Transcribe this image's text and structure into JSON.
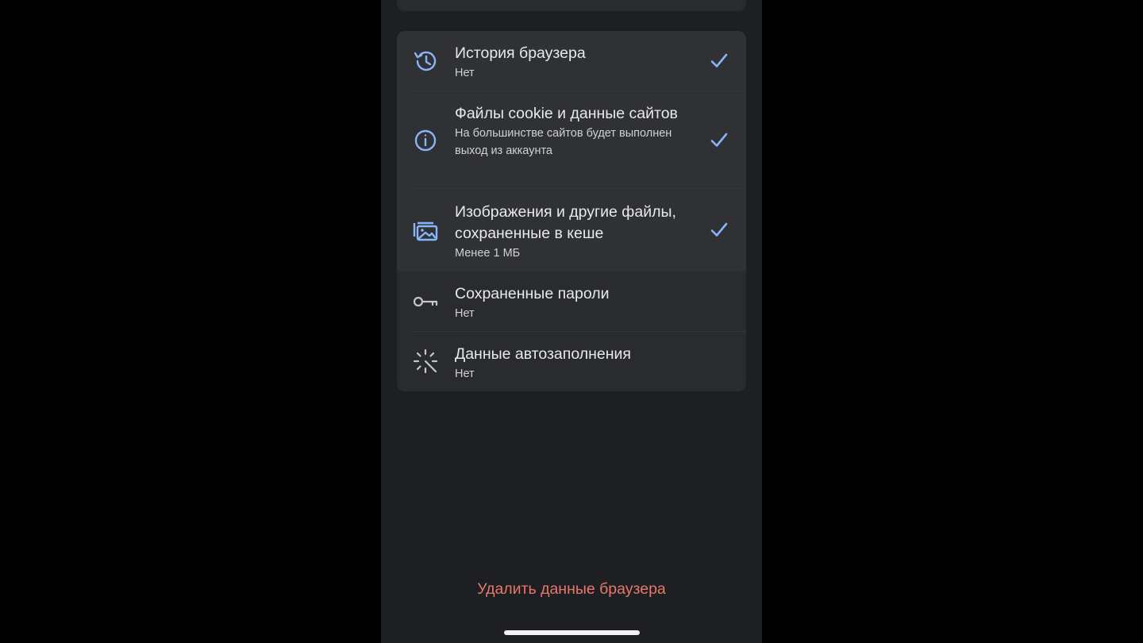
{
  "colors": {
    "accent": "#8ab4f8",
    "destructive": "#e8776b",
    "surface": "#2a2b2f",
    "background": "#1e1f22"
  },
  "items": [
    {
      "title": "История браузера",
      "subtitle": "Нет",
      "icon": "history-icon",
      "checked": true
    },
    {
      "title": "Файлы cookie и данные сайтов",
      "subtitle": "На большинстве сайтов будет выполнен выход из аккаунта",
      "icon": "info-icon",
      "checked": true
    },
    {
      "title": "Изображения и другие файлы, сохраненные в кеше",
      "subtitle": "Менее 1 МБ",
      "icon": "images-icon",
      "checked": true
    },
    {
      "title": "Сохраненные пароли",
      "subtitle": "Нет",
      "icon": "key-icon",
      "checked": false
    },
    {
      "title": "Данные автозаполнения",
      "subtitle": "Нет",
      "icon": "magic-wand-icon",
      "checked": false
    }
  ],
  "delete_button": {
    "label": "Удалить данные браузера"
  }
}
